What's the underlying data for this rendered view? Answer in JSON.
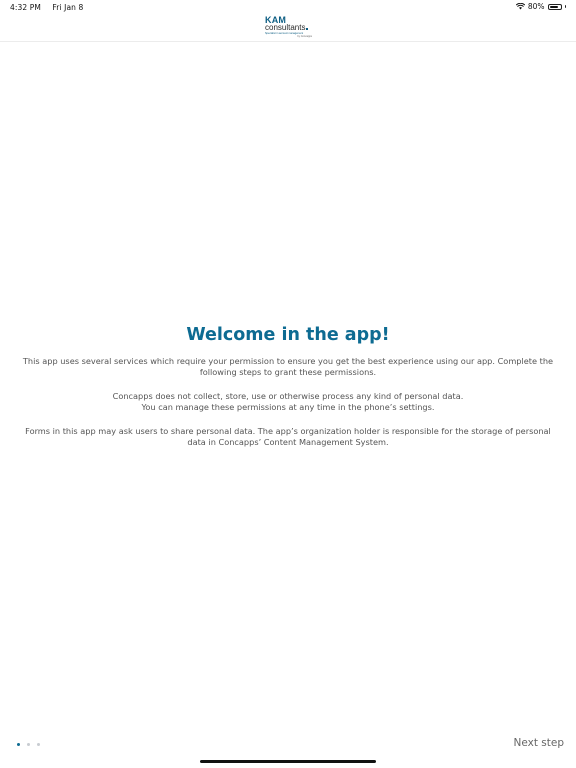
{
  "status_bar": {
    "time": "4:32 PM",
    "date": "Fri Jan 8",
    "battery": "80%",
    "battery_level": 0.8,
    "wifi_icon": "wifi-icon",
    "battery_icon": "battery-icon"
  },
  "header": {
    "logo": {
      "name": "KAM",
      "sub": "consultants",
      "tagline": "Specialist in account management",
      "tagline2": "by Concapps"
    }
  },
  "content": {
    "title": "Welcome in the app!",
    "paragraph_1": "This app uses several services which require your permission to ensure you get the best experience using our app. Complete the following steps to grant these permissions.",
    "paragraph_2_line_1": "Concapps does not collect, store, use or otherwise process any kind of personal data.",
    "paragraph_2_line_2": "You can manage these permissions at any time in the phone’s settings.",
    "paragraph_3": "Forms in this app may ask users to share personal data. The app’s organization holder is responsible for the storage of personal data in Concapps’ Content Management System."
  },
  "footer": {
    "next_label": "Next step",
    "page_indicator": {
      "total": 3,
      "current": 1
    },
    "colors": {
      "accent": "#0d6b92",
      "inactive_dot": "#c8ccd1"
    }
  }
}
